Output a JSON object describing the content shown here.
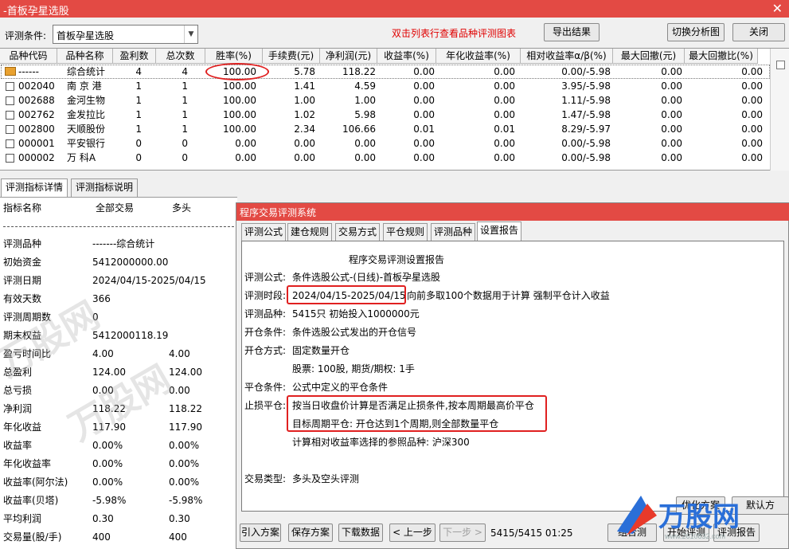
{
  "window": {
    "title": "-首板孕星选股",
    "close": "✕"
  },
  "toolbar": {
    "condition_label": "评测条件:",
    "condition_value": "首板孕星选股",
    "hint": "双击列表行查看品种评测图表",
    "export": "导出结果",
    "switch": "切换分析图",
    "close": "关闭"
  },
  "table": {
    "columns": [
      "品种代码",
      "品种名称",
      "盈利数",
      "总次数",
      "胜率(%)",
      "手续费(元)",
      "净利润(元)",
      "收益率(%)",
      "年化收益率(%)",
      "相对收益率α/β(%)",
      "最大回撤(元)",
      "最大回撤比(%)"
    ],
    "rows": [
      [
        "------",
        "综合统计",
        "4",
        "4",
        "100.00",
        "5.78",
        "118.22",
        "0.00",
        "0.00",
        "0.00/-5.98",
        "0.00",
        "0.00"
      ],
      [
        "002040",
        "南 京 港",
        "1",
        "1",
        "100.00",
        "1.41",
        "4.59",
        "0.00",
        "0.00",
        "3.95/-5.98",
        "0.00",
        "0.00"
      ],
      [
        "002688",
        "金河生物",
        "1",
        "1",
        "100.00",
        "1.00",
        "1.00",
        "0.00",
        "0.00",
        "1.11/-5.98",
        "0.00",
        "0.00"
      ],
      [
        "002762",
        "金发拉比",
        "1",
        "1",
        "100.00",
        "1.02",
        "5.98",
        "0.00",
        "0.00",
        "1.47/-5.98",
        "0.00",
        "0.00"
      ],
      [
        "002800",
        "天顺股份",
        "1",
        "1",
        "100.00",
        "2.34",
        "106.66",
        "0.01",
        "0.01",
        "8.29/-5.97",
        "0.00",
        "0.00"
      ],
      [
        "000001",
        "平安银行",
        "0",
        "0",
        "0.00",
        "0.00",
        "0.00",
        "0.00",
        "0.00",
        "0.00/-5.98",
        "0.00",
        "0.00"
      ],
      [
        "000002",
        "万 科A",
        "0",
        "0",
        "0.00",
        "0.00",
        "0.00",
        "0.00",
        "0.00",
        "0.00/-5.98",
        "0.00",
        "0.00"
      ]
    ]
  },
  "bottom_tabs": [
    "评测指标详情",
    "评测指标说明"
  ],
  "details": {
    "header": [
      "指标名称",
      "全部交易",
      "多头"
    ],
    "rows": [
      [
        "评测品种",
        "-------综合统计",
        ""
      ],
      [
        "初始资金",
        "5412000000.00",
        ""
      ],
      [
        "评测日期",
        "2024/04/15-2025/04/15",
        ""
      ],
      [
        "有效天数",
        "366",
        ""
      ],
      [
        "评测周期数",
        "0",
        ""
      ],
      [
        "期末权益",
        "5412000118.19",
        ""
      ],
      [
        "盈亏时间比",
        "4.00",
        "4.00"
      ],
      [
        "总盈利",
        "124.00",
        "124.00"
      ],
      [
        "总亏损",
        "0.00",
        "0.00"
      ],
      [
        "净利润",
        "118.22",
        "118.22"
      ],
      [
        "年化收益",
        "117.90",
        "117.90"
      ],
      [
        "收益率",
        "0.00%",
        "0.00%"
      ],
      [
        "年化收益率",
        "0.00%",
        "0.00%"
      ],
      [
        "收益率(阿尔法)",
        "0.00%",
        "0.00%"
      ],
      [
        "收益率(贝塔)",
        "-5.98%",
        "-5.98%"
      ],
      [
        "平均利润",
        "0.30",
        "0.30"
      ],
      [
        "交易量(股/手)",
        "400",
        "400"
      ]
    ]
  },
  "dialog": {
    "title": "程序交易评测系统",
    "tabs": [
      "评测公式",
      "建仓规则",
      "交易方式",
      "平仓规则",
      "评测品种",
      "设置报告"
    ],
    "report_title": "程序交易评测设置报告",
    "lines": {
      "formula_label": "评测公式:",
      "formula_value": "条件选股公式-(日线)-首板孕星选股",
      "period_label": "评测时段:",
      "period_value": "2024/04/15-2025/04/15",
      "period_note": "向前多取100个数据用于计算 强制平仓计入收益",
      "variety_label": "评测品种:",
      "variety_value": "5415只 初始投入1000000元",
      "open_cond_label": "开仓条件:",
      "open_cond_value": "条件选股公式发出的开仓信号",
      "open_mode_label": "开仓方式:",
      "open_mode_value": "固定数量开仓",
      "open_mode_detail": "股票: 100股, 期货/期权: 1手",
      "close_cond_label": "平仓条件:",
      "close_cond_value": "公式中定义的平仓条件",
      "stop_label": "止损平仓:",
      "stop_value": "按当日收盘价计算是否满足止损条件,按本周期最高价平仓",
      "target_value": "目标周期平仓: 开仓达到1个周期,则全部数量平仓",
      "ref_value": "计算相对收益率选择的参照品种: 沪深300",
      "type_label": "交易类型:",
      "type_value": "多头及空头评测"
    },
    "buttons": {
      "import": "引入方案",
      "save": "保存方案",
      "download": "下载数据",
      "prev": "< 上一步",
      "next": "下一步 >",
      "status": "5415/5415 01:25",
      "combo": "组合测",
      "start": "开始评测",
      "report": "评测报告",
      "hidden1": "优化方案",
      "default": "默认方"
    }
  },
  "watermark": {
    "text": "万股网",
    "logo_text": "万股网",
    "url": "www.2610832.com"
  }
}
